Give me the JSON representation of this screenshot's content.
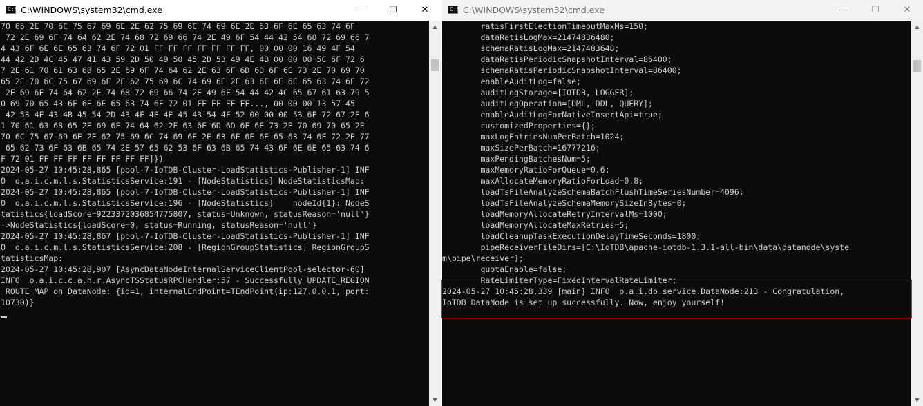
{
  "left_window": {
    "title": "C:\\WINDOWS\\system32\\cmd.exe",
    "lines": [
      "70 65 2E 70 6C 75 67 69 6E 2E 62 75 69 6C 74 69 6E 2E 63 6F 6E 65 63 74 6F",
      " 72 2E 69 6F 74 64 62 2E 74 68 72 69 66 74 2E 49 6F 54 44 42 54 68 72 69 66 7",
      "4 43 6F 6E 6E 65 63 74 6F 72 01 FF FF FF FF FF FF FF, 00 00 00 16 49 4F 54",
      "44 42 2D 4C 45 47 41 43 59 2D 50 49 50 45 2D 53 49 4E 4B 00 00 00 5C 6F 72 6",
      "7 2E 61 70 61 63 68 65 2E 69 6F 74 64 62 2E 63 6F 6D 6D 6F 6E 73 2E 70 69 70",
      "65 2E 70 6C 75 67 69 6E 2E 62 75 69 6C 74 69 6E 2E 63 6F 6E 6E 65 63 74 6F 72",
      " 2E 69 6F 74 64 62 2E 74 68 72 69 66 74 2E 49 6F 54 44 42 4C 65 67 61 63 79 5",
      "0 69 70 65 43 6F 6E 6E 65 63 74 6F 72 01 FF FF FF FF..., 00 00 00 13 57 45",
      " 42 53 4F 43 4B 45 54 2D 43 4F 4E 4E 45 43 54 4F 52 00 00 00 53 6F 72 67 2E 6",
      "1 70 61 63 68 65 2E 69 6F 74 64 62 2E 63 6F 6D 6D 6F 6E 73 2E 70 69 70 65 2E",
      "70 6C 75 67 69 6E 2E 62 75 69 6C 74 69 6E 2E 63 6F 6E 6E 65 63 74 6F 72 2E 77",
      " 65 62 73 6F 63 6B 65 74 2E 57 65 62 53 6F 63 6B 65 74 43 6F 6E 6E 65 63 74 6",
      "F 72 01 FF FF FF FF FF FF FF FF]})",
      "2024-05-27 10:45:28,865 [pool-7-IoTDB-Cluster-LoadStatistics-Publisher-1] INF",
      "O  o.a.i.c.m.l.s.StatisticsService:191 - [NodeStatistics] NodeStatisticsMap:",
      "2024-05-27 10:45:28,865 [pool-7-IoTDB-Cluster-LoadStatistics-Publisher-1] INF",
      "O  o.a.i.c.m.l.s.StatisticsService:196 - [NodeStatistics]    nodeId{1}: NodeS",
      "tatistics{loadScore=9223372036854775807, status=Unknown, statusReason='null'}",
      "->NodeStatistics{loadScore=0, status=Running, statusReason='null'}",
      "2024-05-27 10:45:28,867 [pool-7-IoTDB-Cluster-LoadStatistics-Publisher-1] INF",
      "O  o.a.i.c.m.l.s.StatisticsService:208 - [RegionGroupStatistics] RegionGroupS",
      "tatisticsMap:",
      "2024-05-27 10:45:28,907 [AsyncDataNodeInternalServiceClientPool-selector-60]",
      "INFO  o.a.i.c.c.a.h.r.AsyncTSStatusRPCHandler:57 - Successfully UPDATE_REGION",
      "_ROUTE_MAP on DataNode: {id=1, internalEndPoint=TEndPoint(ip:127.0.0.1, port:",
      "10730)}"
    ]
  },
  "right_window": {
    "title": "C:\\WINDOWS\\system32\\cmd.exe",
    "lines": [
      "        ratisFirstElectionTimeoutMaxMs=150;",
      "        dataRatisLogMax=21474836480;",
      "        schemaRatisLogMax=2147483648;",
      "        dataRatisPeriodicSnapshotInterval=86400;",
      "        schemaRatisPeriodicSnapshotInterval=86400;",
      "        enableAuditLog=false;",
      "        auditLogStorage=[IOTDB, LOGGER];",
      "        auditLogOperation=[DML, DDL, QUERY];",
      "        enableAuditLogForNativeInsertApi=true;",
      "        customizedProperties={};",
      "        maxLogEntriesNumPerBatch=1024;",
      "        maxSizePerBatch=16777216;",
      "        maxPendingBatchesNum=5;",
      "        maxMemoryRatioForQueue=0.6;",
      "        maxAllocateMemoryRatioForLoad=0.8;",
      "        loadTsFileAnalyzeSchemaBatchFlushTimeSeriesNumber=4096;",
      "        loadTsFileAnalyzeSchemaMemorySizeInBytes=0;",
      "        loadMemoryAllocateRetryIntervalMs=1000;",
      "        loadMemoryAllocateMaxRetries=5;",
      "        loadCleanupTaskExecutionDelayTimeSeconds=1800;",
      "        pipeReceiverFileDirs=[C:\\IoTDB\\apache-iotdb-1.3.1-all-bin\\data\\datanode\\syste",
      "m\\pipe\\receiver];",
      "        quotaEnable=false;",
      "        RateLimiterType=FixedIntervalRateLimiter;",
      "2024-05-27 10:45:28,339 [main] INFO  o.a.i.db.service.DataNode:213 - Congratulation,",
      "IoTDB DataNode is set up successfully. Now, enjoy yourself!"
    ]
  },
  "icons": {
    "app": "cmd-icon",
    "minimize_glyph": "—",
    "maximize_glyph": "☐",
    "close_glyph": "✕",
    "up_arrow": "▲",
    "down_arrow": "▼"
  },
  "colors": {
    "console_bg": "#0c0c0c",
    "console_text": "#cccccc",
    "highlight_border": "#d9262c"
  }
}
